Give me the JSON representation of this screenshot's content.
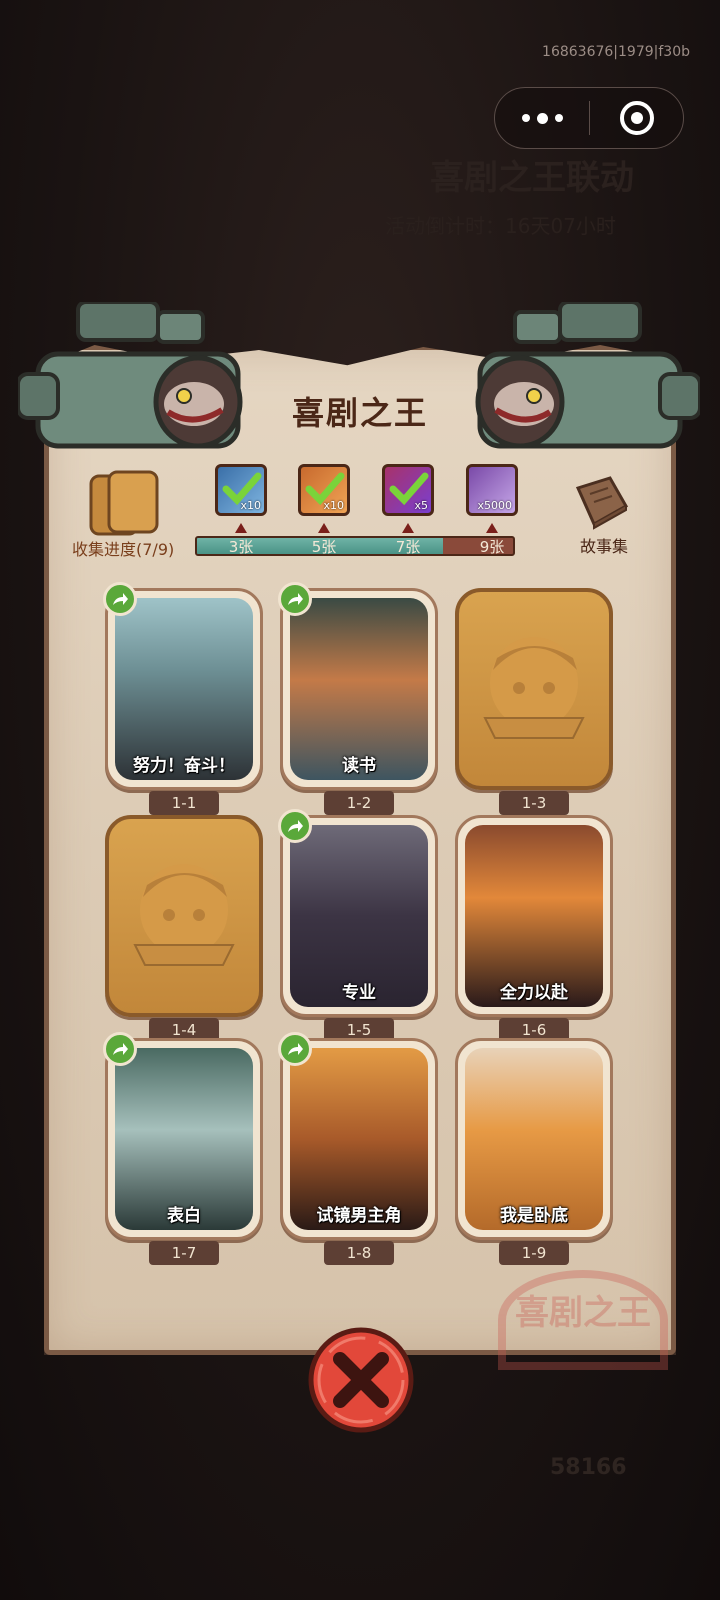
{
  "build_id": "16863676|1979|f30b",
  "background": {
    "title": "喜剧之王联动",
    "countdown": "活动倒计时：16天07小时",
    "coins": "58166"
  },
  "panel": {
    "title": "喜剧之王",
    "collect_label": "收集进度(7/9)",
    "story_label": "故事集",
    "progress": {
      "collected": 7,
      "total": 9,
      "milestones": [
        {
          "label": "3张",
          "reward_qty": "x10",
          "reward": "ticket-blue-icon",
          "claimed": true
        },
        {
          "label": "5张",
          "reward_qty": "x10",
          "reward": "ticket-orange-icon",
          "claimed": true
        },
        {
          "label": "7张",
          "reward_qty": "x5",
          "reward": "gem-ball-icon",
          "claimed": true
        },
        {
          "label": "9张",
          "reward_qty": "x5000",
          "reward": "crystal-icon",
          "claimed": false
        }
      ]
    },
    "cards": [
      {
        "id": "1-1",
        "caption": "努力！奋斗！",
        "unlocked": true,
        "shareable": true
      },
      {
        "id": "1-2",
        "caption": "读书",
        "unlocked": true,
        "shareable": true
      },
      {
        "id": "1-3",
        "caption": "",
        "unlocked": false,
        "shareable": false
      },
      {
        "id": "1-4",
        "caption": "",
        "unlocked": false,
        "shareable": false
      },
      {
        "id": "1-5",
        "caption": "专业",
        "unlocked": true,
        "shareable": true
      },
      {
        "id": "1-6",
        "caption": "全力以赴",
        "unlocked": true,
        "shareable": false
      },
      {
        "id": "1-7",
        "caption": "表白",
        "unlocked": true,
        "shareable": true
      },
      {
        "id": "1-8",
        "caption": "试镜男主角",
        "unlocked": true,
        "shareable": true
      },
      {
        "id": "1-9",
        "caption": "我是卧底",
        "unlocked": true,
        "shareable": false
      }
    ],
    "stamp_text": "喜剧之王"
  },
  "colors": {
    "accent_red": "#e2483a",
    "progress_fill": "#4a9386",
    "parchment": "#e0d0ba",
    "card_gold": "#c98c3c",
    "share_green": "#5aa83a"
  }
}
